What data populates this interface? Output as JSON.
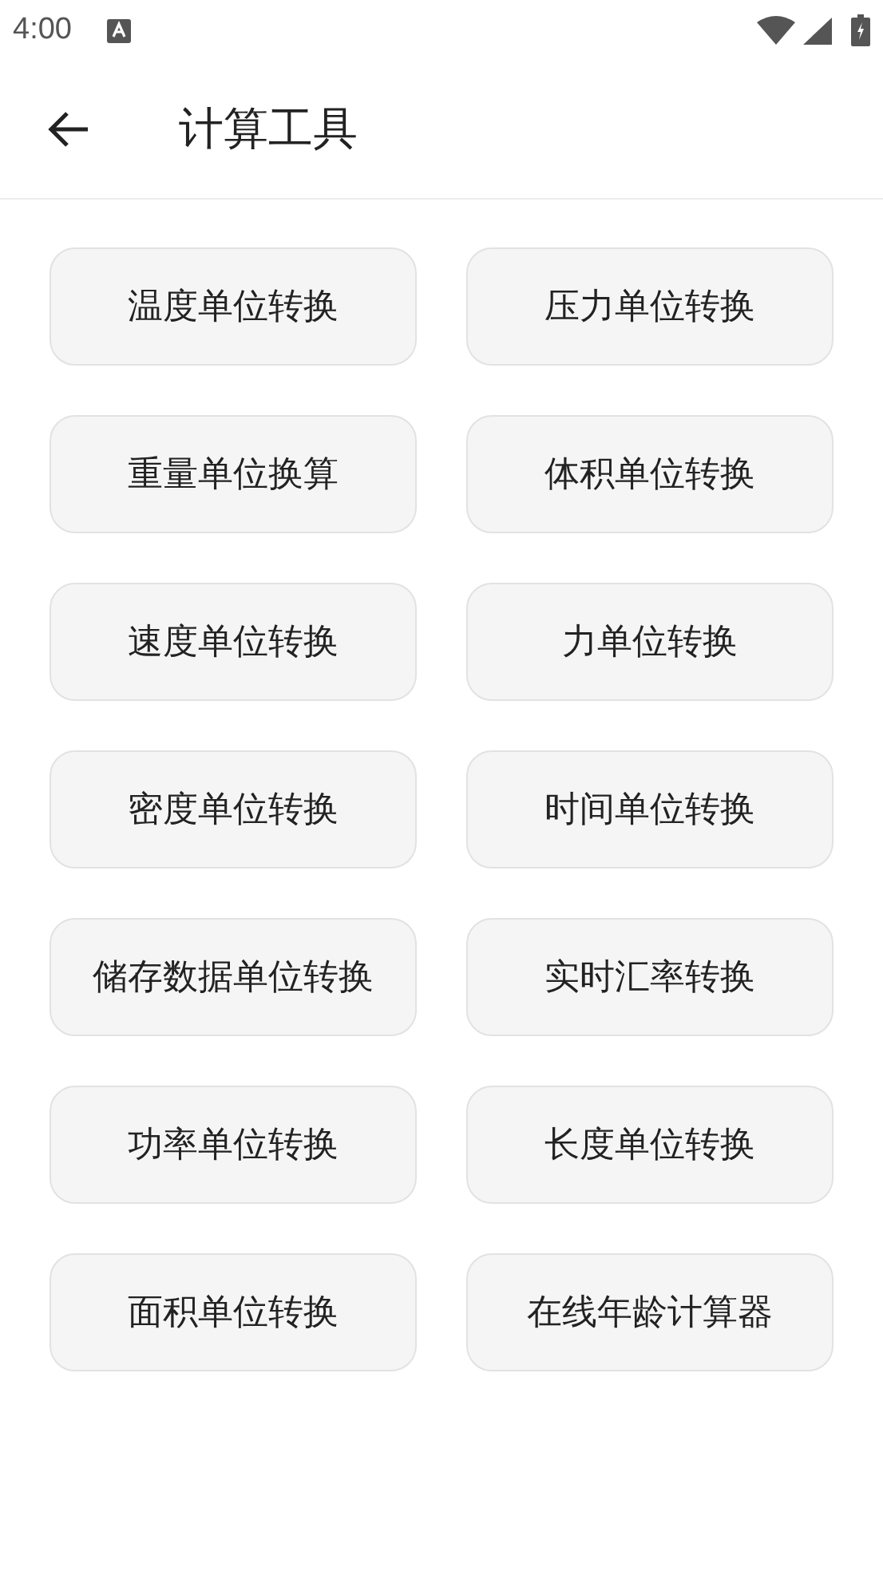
{
  "status_bar": {
    "time": "4:00"
  },
  "app_bar": {
    "title": "计算工具"
  },
  "tools": [
    {
      "label": "温度单位转换"
    },
    {
      "label": "压力单位转换"
    },
    {
      "label": "重量单位换算"
    },
    {
      "label": "体积单位转换"
    },
    {
      "label": "速度单位转换"
    },
    {
      "label": "力单位转换"
    },
    {
      "label": "密度单位转换"
    },
    {
      "label": "时间单位转换"
    },
    {
      "label": "储存数据单位转换"
    },
    {
      "label": "实时汇率转换"
    },
    {
      "label": "功率单位转换"
    },
    {
      "label": "长度单位转换"
    },
    {
      "label": "面积单位转换"
    },
    {
      "label": "在线年龄计算器"
    }
  ]
}
